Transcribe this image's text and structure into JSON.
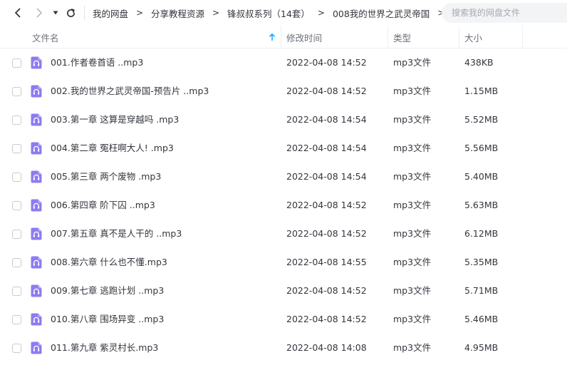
{
  "toolbar": {
    "back": "chevron-left-icon",
    "forward": "chevron-right-icon",
    "history": "dropdown-triangle-icon",
    "refresh": "refresh-icon"
  },
  "breadcrumb": {
    "items": [
      "我的网盘",
      "分享教程资源",
      "锋叔叔系列（14套）",
      "008我的世界之武灵帝国"
    ],
    "separator": ">"
  },
  "search": {
    "placeholder": "搜索我的网盘文件",
    "value": ""
  },
  "columns": {
    "name": "文件名",
    "modified": "修改时间",
    "type": "类型",
    "size": "大小",
    "sort_icon": "sort-ascending-arrow-icon"
  },
  "colors": {
    "icon_accent": "#8c7cf0",
    "text": "#33363d",
    "muted": "#6b6f78",
    "sort_arrow": "#06a7ff"
  },
  "files": [
    {
      "name": "001.作者卷首语 ..mp3",
      "modified": "2022-04-08 14:52",
      "type": "mp3文件",
      "size": "438KB"
    },
    {
      "name": "002.我的世界之武灵帝国-预告片 ..mp3",
      "modified": "2022-04-08 14:52",
      "type": "mp3文件",
      "size": "1.15MB"
    },
    {
      "name": "003.第一章 这算是穿越吗 .mp3",
      "modified": "2022-04-08 14:54",
      "type": "mp3文件",
      "size": "5.52MB"
    },
    {
      "name": "004.第二章 冤枉啊大人! .mp3",
      "modified": "2022-04-08 14:54",
      "type": "mp3文件",
      "size": "5.56MB"
    },
    {
      "name": "005.第三章 两个废物 .mp3",
      "modified": "2022-04-08 14:54",
      "type": "mp3文件",
      "size": "5.40MB"
    },
    {
      "name": "006.第四章 阶下囚 ..mp3",
      "modified": "2022-04-08 14:52",
      "type": "mp3文件",
      "size": "5.63MB"
    },
    {
      "name": "007.第五章 真不是人干的 ..mp3",
      "modified": "2022-04-08 14:52",
      "type": "mp3文件",
      "size": "6.12MB"
    },
    {
      "name": "008.第六章 什么也不懂.mp3",
      "modified": "2022-04-08 14:55",
      "type": "mp3文件",
      "size": "5.35MB"
    },
    {
      "name": "009.第七章 逃跑计划 ..mp3",
      "modified": "2022-04-08 14:52",
      "type": "mp3文件",
      "size": "5.71MB"
    },
    {
      "name": "010.第八章 围场异变 ..mp3",
      "modified": "2022-04-08 14:52",
      "type": "mp3文件",
      "size": "5.46MB"
    },
    {
      "name": "011.第九章 紫灵村长.mp3",
      "modified": "2022-04-08 14:08",
      "type": "mp3文件",
      "size": "4.95MB"
    }
  ]
}
